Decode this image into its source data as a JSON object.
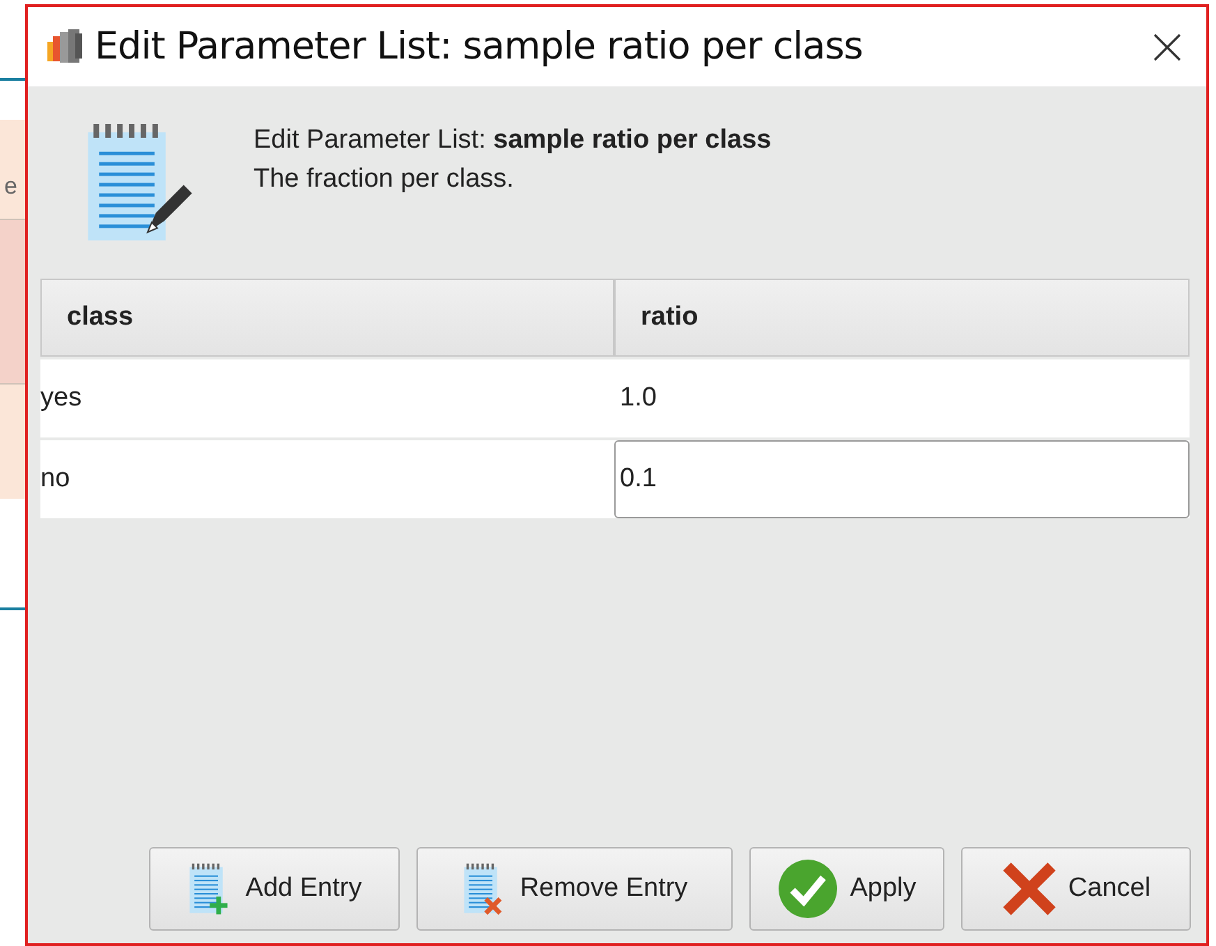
{
  "background_window": {
    "column_header": "e"
  },
  "window": {
    "title": "Edit Parameter List: sample ratio per class"
  },
  "header": {
    "heading": "Edit Parameter List: **sample ratio per class**",
    "description": "The fraction per class."
  },
  "table": {
    "columns": [
      "class",
      "ratio"
    ],
    "rows": [
      {
        "cells": [
          "yes",
          "1.0"
        ],
        "editing": false
      },
      {
        "cells": [
          "no",
          "0.1"
        ],
        "editing": true
      }
    ]
  },
  "buttons": [
    {
      "label": "Add Entry",
      "kind": "add"
    },
    {
      "label": "Remove Entry",
      "kind": "remove"
    },
    {
      "label": "Apply",
      "kind": "apply"
    },
    {
      "label": "Cancel",
      "kind": "cancel"
    }
  ]
}
